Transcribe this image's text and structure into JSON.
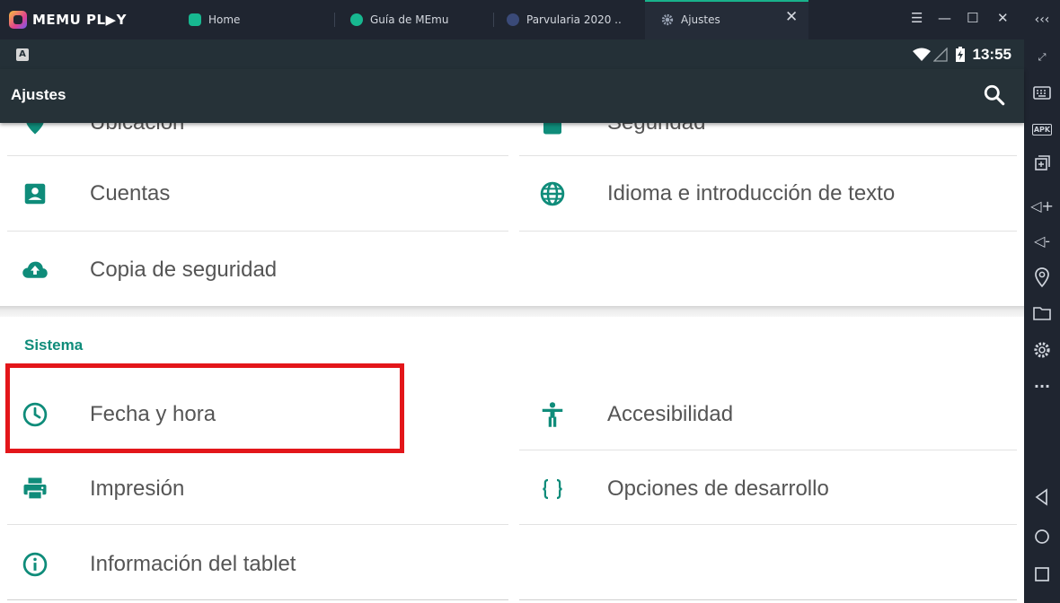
{
  "emulator": {
    "brand": "MEMU PL▶Y",
    "tabs": [
      {
        "label": "Home",
        "icon": "memu-home-icon",
        "color": "#17b890"
      },
      {
        "label": "Guía de MEmu",
        "icon": "help-icon",
        "color": "#17b890"
      },
      {
        "label": "Parvularia 2020 ..",
        "icon": "app-icon",
        "color": "#3a4a78"
      },
      {
        "label": "Ajustes",
        "icon": "settings-gear-icon",
        "color": "#9aa4b5"
      }
    ],
    "active_tab": 3
  },
  "statusbar": {
    "notification_letter": "A",
    "time": "13:55"
  },
  "appbar": {
    "title": "Ajustes"
  },
  "settings": {
    "top_partial": [
      {
        "label": "Ubicación",
        "icon": "location-icon"
      },
      {
        "label": "Seguridad",
        "icon": "lock-icon"
      }
    ],
    "personal": [
      {
        "label": "Cuentas",
        "icon": "account-icon"
      },
      {
        "label": "Idioma e introducción de texto",
        "icon": "globe-icon"
      },
      {
        "label": "Copia de seguridad",
        "icon": "cloud-upload-icon"
      }
    ],
    "system_title": "Sistema",
    "system": [
      {
        "label": "Fecha y hora",
        "icon": "clock-icon"
      },
      {
        "label": "Accesibilidad",
        "icon": "accessibility-icon"
      },
      {
        "label": "Impresión",
        "icon": "printer-icon"
      },
      {
        "label": "Opciones de desarrollo",
        "icon": "code-braces-icon"
      },
      {
        "label": "Información del tablet",
        "icon": "info-icon"
      }
    ]
  },
  "sidebar": {
    "apk_label": "APK"
  },
  "colors": {
    "accent": "#0f8c7a",
    "highlight": "#e3161a",
    "appbar": "#263238"
  }
}
